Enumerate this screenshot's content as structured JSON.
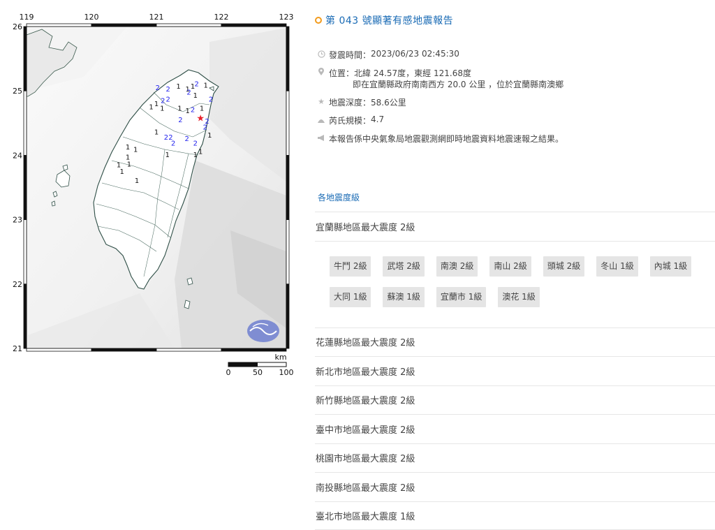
{
  "map": {
    "lon_labels": [
      "119",
      "120",
      "121",
      "122",
      "123"
    ],
    "lat_labels": [
      "26",
      "25",
      "24",
      "23",
      "22",
      "21"
    ],
    "scale_unit": "km",
    "scale_labels": [
      "0",
      "50",
      "100"
    ],
    "epicenter_lat": 24.57,
    "epicenter_lon": 121.68,
    "station_marks": [
      {
        "v": "2",
        "lon": 121.02,
        "lat": 25.04
      },
      {
        "v": "2",
        "lon": 121.18,
        "lat": 25.02
      },
      {
        "v": "1",
        "lon": 121.34,
        "lat": 25.06
      },
      {
        "v": "1",
        "lon": 121.48,
        "lat": 25.02
      },
      {
        "v": "1",
        "lon": 121.56,
        "lat": 25.06
      },
      {
        "v": "2",
        "lon": 121.62,
        "lat": 25.1
      },
      {
        "v": "1",
        "lon": 121.76,
        "lat": 25.08
      },
      {
        "v": "2",
        "lon": 121.5,
        "lat": 24.97
      },
      {
        "v": "1",
        "lon": 121.6,
        "lat": 24.92
      },
      {
        "v": "2",
        "lon": 121.1,
        "lat": 24.84
      },
      {
        "v": "2",
        "lon": 121.18,
        "lat": 24.86
      },
      {
        "v": "1",
        "lon": 121.0,
        "lat": 24.79
      },
      {
        "v": "1",
        "lon": 120.92,
        "lat": 24.74
      },
      {
        "v": "1",
        "lon": 121.09,
        "lat": 24.72
      },
      {
        "v": "1",
        "lon": 121.36,
        "lat": 24.72
      },
      {
        "v": "2",
        "lon": 121.56,
        "lat": 24.7
      },
      {
        "v": "1",
        "lon": 121.48,
        "lat": 24.68
      },
      {
        "v": "1",
        "lon": 121.7,
        "lat": 24.72
      },
      {
        "v": "2",
        "lon": 121.84,
        "lat": 24.86
      },
      {
        "v": "2",
        "lon": 121.37,
        "lat": 24.54
      },
      {
        "v": "2",
        "lon": 121.78,
        "lat": 24.52
      },
      {
        "v": "2",
        "lon": 121.75,
        "lat": 24.43
      },
      {
        "v": "1",
        "lon": 121.0,
        "lat": 24.35
      },
      {
        "v": "2",
        "lon": 121.15,
        "lat": 24.27
      },
      {
        "v": "2",
        "lon": 121.22,
        "lat": 24.27
      },
      {
        "v": "2",
        "lon": 121.47,
        "lat": 24.25
      },
      {
        "v": "2",
        "lon": 121.26,
        "lat": 24.18
      },
      {
        "v": "2",
        "lon": 121.6,
        "lat": 24.18
      },
      {
        "v": "1",
        "lon": 121.82,
        "lat": 24.3
      },
      {
        "v": "1",
        "lon": 121.68,
        "lat": 24.05
      },
      {
        "v": "1",
        "lon": 121.6,
        "lat": 24.0
      },
      {
        "v": "1",
        "lon": 121.17,
        "lat": 24.0
      },
      {
        "v": "1",
        "lon": 120.56,
        "lat": 24.12
      },
      {
        "v": "1",
        "lon": 120.68,
        "lat": 24.08
      },
      {
        "v": "1",
        "lon": 120.56,
        "lat": 23.96
      },
      {
        "v": "1",
        "lon": 120.58,
        "lat": 23.85
      },
      {
        "v": "1",
        "lon": 120.47,
        "lat": 23.74
      },
      {
        "v": "1",
        "lon": 120.42,
        "lat": 23.84
      },
      {
        "v": "1",
        "lon": 120.7,
        "lat": 23.6
      }
    ]
  },
  "report": {
    "title": "第 043 號顯著有感地震報告",
    "info": [
      {
        "icon": "clock-icon",
        "label": "發震時間：",
        "value": "2023/06/23 02:45:30"
      },
      {
        "icon": "pin-icon",
        "label": "位置：",
        "value": "北緯 24.57度，東經 121.68度"
      },
      {
        "icon": "star-icon",
        "label": "地震深度：",
        "value": "58.6公里"
      },
      {
        "icon": "waves-icon",
        "label": "芮氏規模：",
        "value": "4.7"
      },
      {
        "icon": "megaphone-icon",
        "label": "",
        "value": "本報告係中央氣象局地震觀測網即時地震資料地震速報之結果。"
      }
    ],
    "location_detail": "即在宜蘭縣政府南南西方 20.0 公里 ，位於宜蘭縣南澳鄉",
    "section_title": "各地震度級",
    "areas": [
      "宜蘭縣地區最大震度 2級",
      "花蓮縣地區最大震度 2級",
      "新北市地區最大震度 2級",
      "新竹縣地區最大震度 2級",
      "臺中市地區最大震度 2級",
      "桃園市地區最大震度 2級",
      "南投縣地區最大震度 2級",
      "臺北市地區最大震度 1級"
    ],
    "towns": [
      "牛鬥 2級",
      "武塔 2級",
      "南澳 2級",
      "南山 2級",
      "頭城 2級",
      "冬山 1級",
      "內城 1級",
      "大同 1級",
      "蘇澳 1級",
      "宜蘭市 1級",
      "澳花 1級"
    ]
  },
  "colors": {
    "link": "#1a6bb5",
    "title_dot": "#f29b1d",
    "intensity_1": "#111111",
    "intensity_2": "#2222ee",
    "epicenter": "#e8202a"
  }
}
